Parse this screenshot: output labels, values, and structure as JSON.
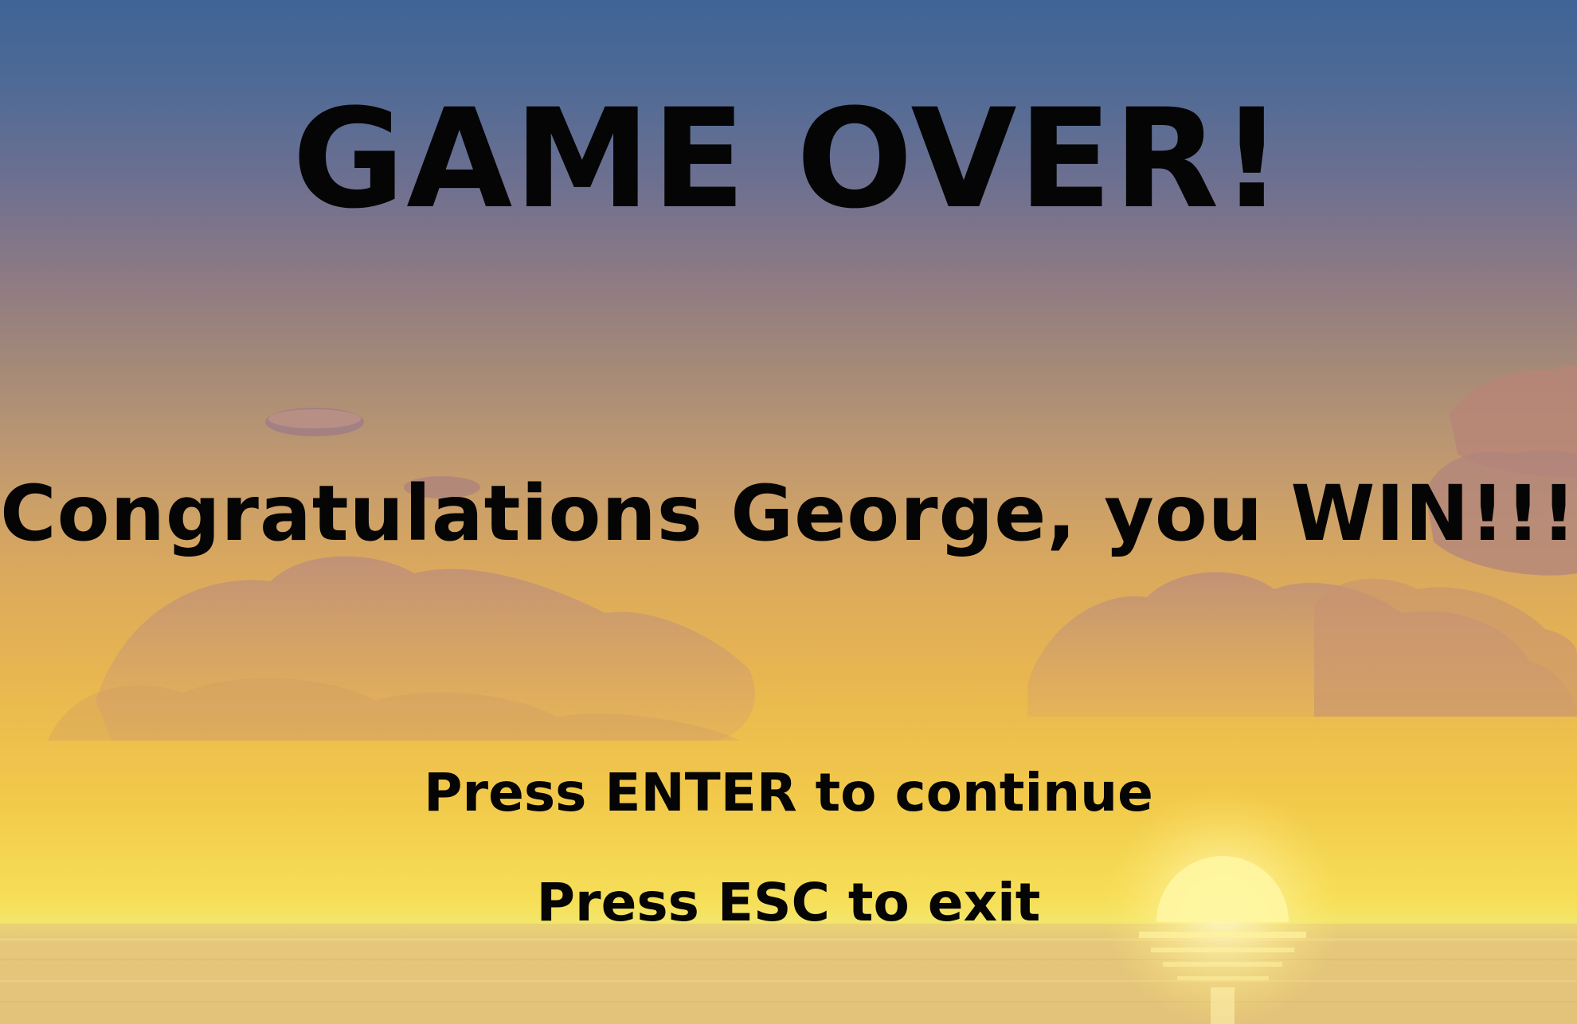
{
  "screen": {
    "title": "GAME OVER!",
    "message": "Congratulations George, you WIN!!!",
    "continue_prompt": "Press ENTER to continue",
    "exit_prompt": "Press ESC to exit"
  },
  "background": {
    "scene": "sunset-over-sea",
    "sky_top_color": "#3f6496",
    "sky_bottom_color": "#f6df58",
    "sea_color": "#e2c07a",
    "sun_color": "#fff6a0"
  }
}
